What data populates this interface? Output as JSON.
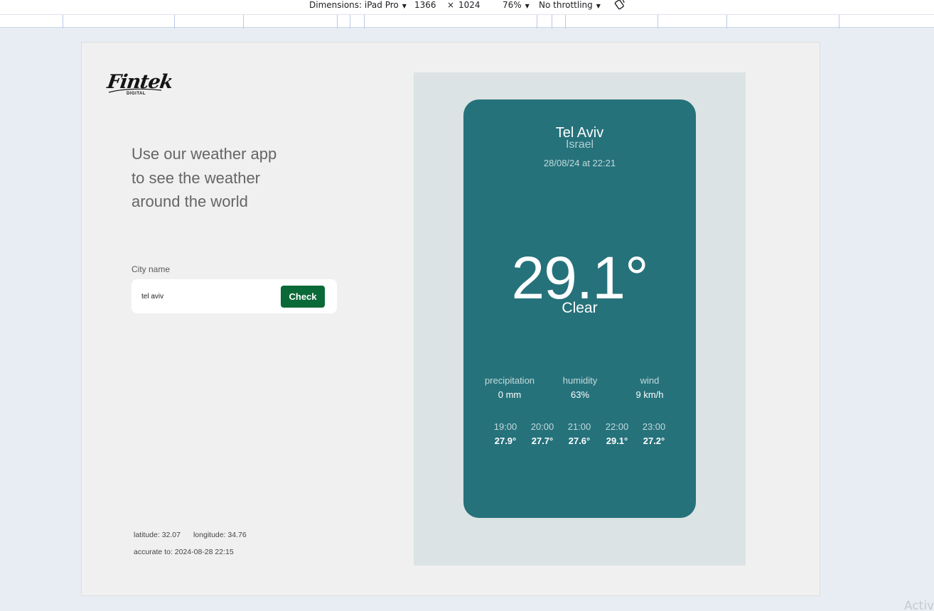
{
  "devtools": {
    "dimensions_label": "Dimensions: iPad Pro",
    "width": "1366",
    "times": "×",
    "height": "1024",
    "zoom": "76%",
    "throttling": "No throttling"
  },
  "watermark": "Activ",
  "logo": {
    "script": "Fintek",
    "sub": "DIGITAL"
  },
  "headline": "Use our weather app to see the weather around the world",
  "search": {
    "label": "City name",
    "value": "tel aviv",
    "button": "Check"
  },
  "coords": {
    "latitude": "latitude: 32.07",
    "longitude": "longitude: 34.76",
    "accurate": "accurate to: 2024-08-28 22:15"
  },
  "weather": {
    "city": "Tel Aviv",
    "country": "Israel",
    "datetime": "28/08/24 at 22:21",
    "temp": "29.1°",
    "condition": "Clear",
    "stats": [
      {
        "label": "precipitation",
        "value": "0 mm"
      },
      {
        "label": "humidity",
        "value": "63%"
      },
      {
        "label": "wind",
        "value": "9 km/h"
      }
    ],
    "forecast": [
      {
        "time": "19:00",
        "temp": "27.9°"
      },
      {
        "time": "20:00",
        "temp": "27.7°"
      },
      {
        "time": "21:00",
        "temp": "27.6°"
      },
      {
        "time": "22:00",
        "temp": "29.1°"
      },
      {
        "time": "23:00",
        "temp": "27.2°"
      }
    ]
  },
  "colors": {
    "card": "#26727b",
    "panel": "#dce3e4",
    "page": "#f0f0f0",
    "button": "#0a6a37"
  }
}
